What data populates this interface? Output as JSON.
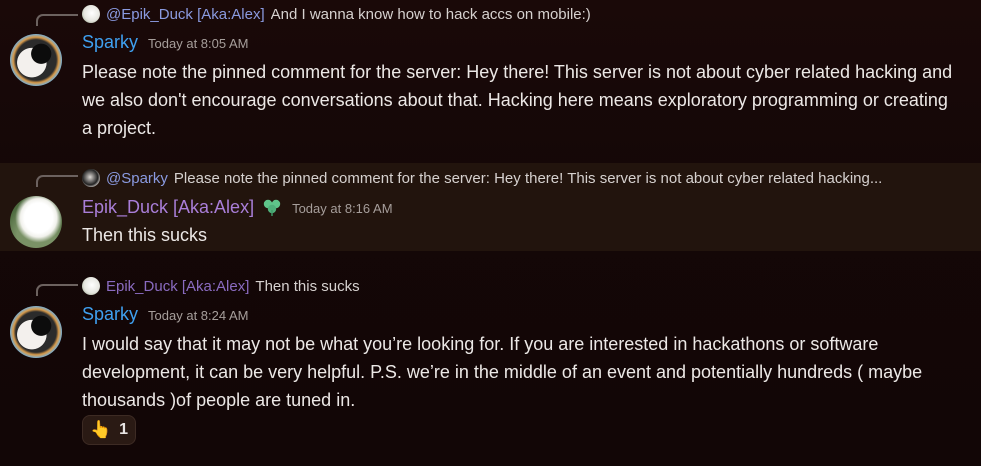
{
  "messages": [
    {
      "reply": {
        "author": "@Epik_Duck [Aka:Alex]",
        "text": "And I wanna know how to hack accs on mobile:)"
      },
      "author": "Sparky",
      "timestamp": "Today at 8:05 AM",
      "body": "Please note the pinned comment for the server: Hey there! This server is not about cyber related hacking and we also don't encourage conversations about that. Hacking here means exploratory programming or creating a project."
    },
    {
      "reply": {
        "author": "@Sparky",
        "text": "Please note the pinned comment for the server: Hey there! This server is not about cyber related hacking..."
      },
      "author": "Epik_Duck [Aka:Alex]",
      "timestamp": "Today at 8:16 AM",
      "body": "Then this sucks"
    },
    {
      "reply": {
        "author": "Epik_Duck [Aka:Alex]",
        "text": "Then this sucks"
      },
      "author": "Sparky",
      "timestamp": "Today at 8:24 AM",
      "body": "I would say that it may not be what you’re looking for. If you are interested in hackathons or software development, it can be very helpful. P.S. we’re in the middle of an event and potentially hundreds ( maybe thousands )of people are tuned in.",
      "reaction": {
        "emoji": "👆",
        "count": "1"
      }
    }
  ],
  "colors": {
    "sparky_name": "#3fa0f0",
    "duck_name": "#a97ed8",
    "highlight": "#22140d"
  },
  "icons": {
    "badge": "clover-badge-icon",
    "reaction": "pointing-up-emoji"
  }
}
